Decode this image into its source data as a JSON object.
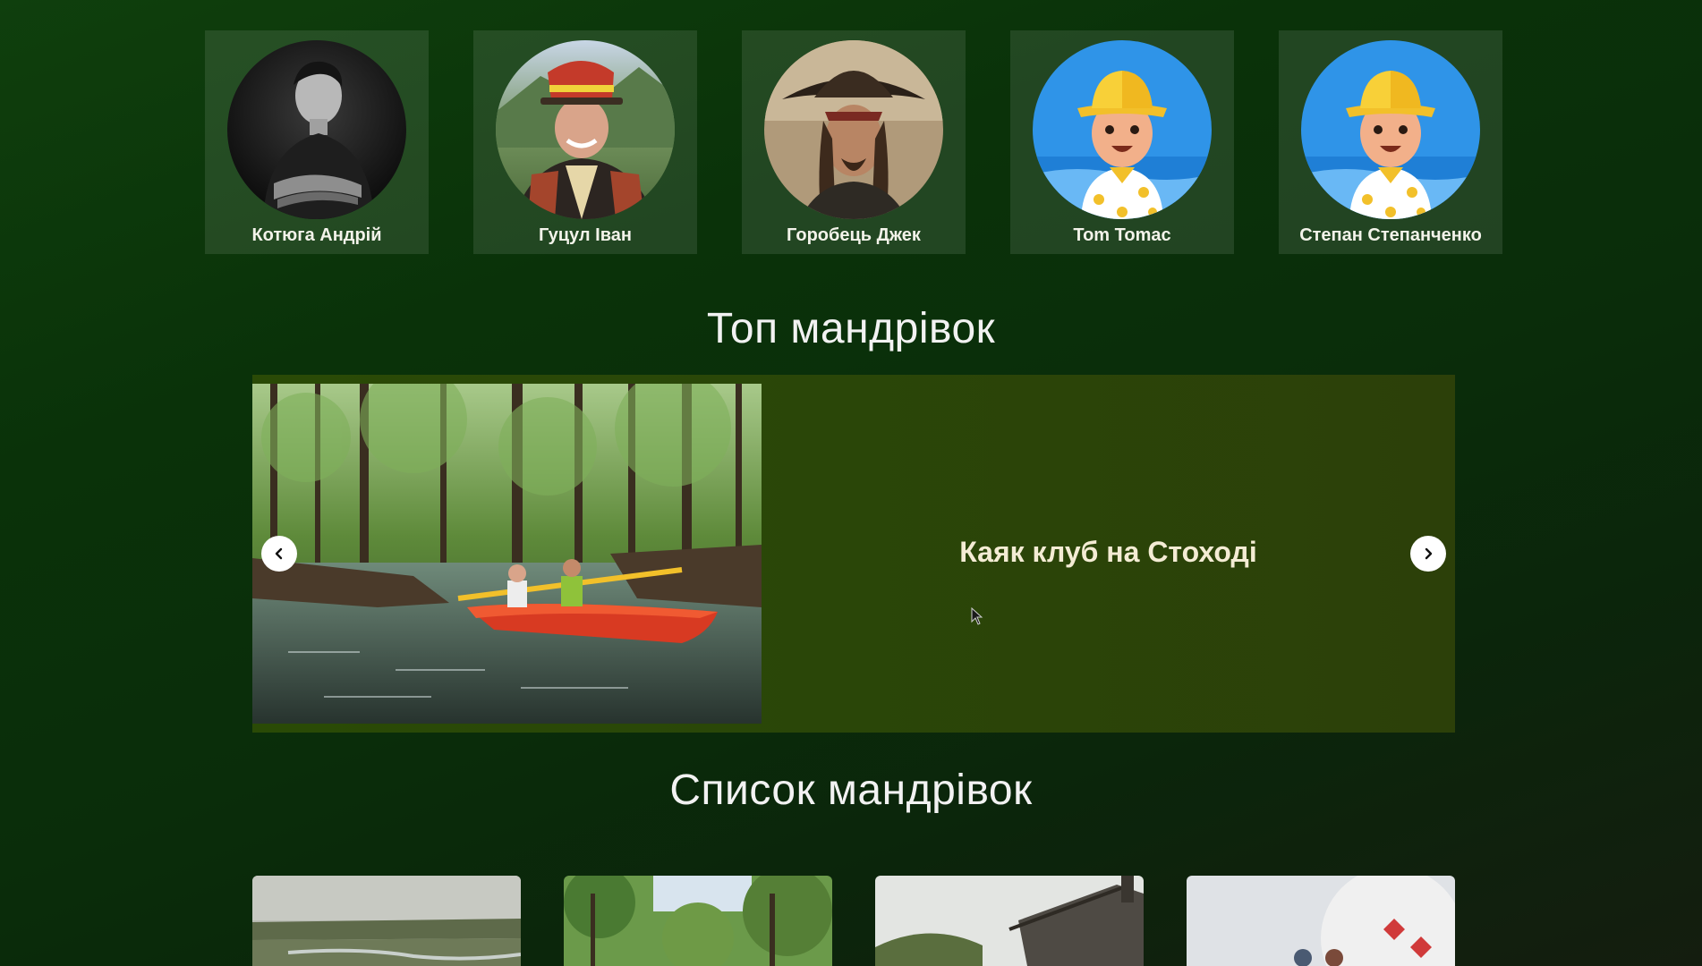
{
  "guides": [
    {
      "name": "Котюга Андрій",
      "avatar": "portrait-photo"
    },
    {
      "name": "Гуцул Іван",
      "avatar": "portrait-photo"
    },
    {
      "name": "Горобець Джек",
      "avatar": "portrait-photo"
    },
    {
      "name": "Tom Tomac",
      "avatar": "default-avatar-illustration"
    },
    {
      "name": "Степан Степанченко",
      "avatar": "default-avatar-illustration"
    }
  ],
  "top_section": {
    "title": "Топ мандрівок",
    "slide": {
      "caption": "Каяк клуб на Стоході",
      "image": "kayak-river-photo"
    },
    "prev_icon": "chevron-left-icon",
    "next_icon": "chevron-right-icon"
  },
  "list_section": {
    "title": "Список мандрівок",
    "tours": [
      {
        "image": "river-valley-photo"
      },
      {
        "image": "forest-photo"
      },
      {
        "image": "village-house-photo"
      },
      {
        "image": "observatory-dome-photo"
      }
    ]
  },
  "colors": {
    "background": "#0b330b",
    "card_overlay": "rgba(255,255,255,0.10)",
    "carousel_bg": "#2a4708",
    "caption_text": "#f4ecd4"
  }
}
